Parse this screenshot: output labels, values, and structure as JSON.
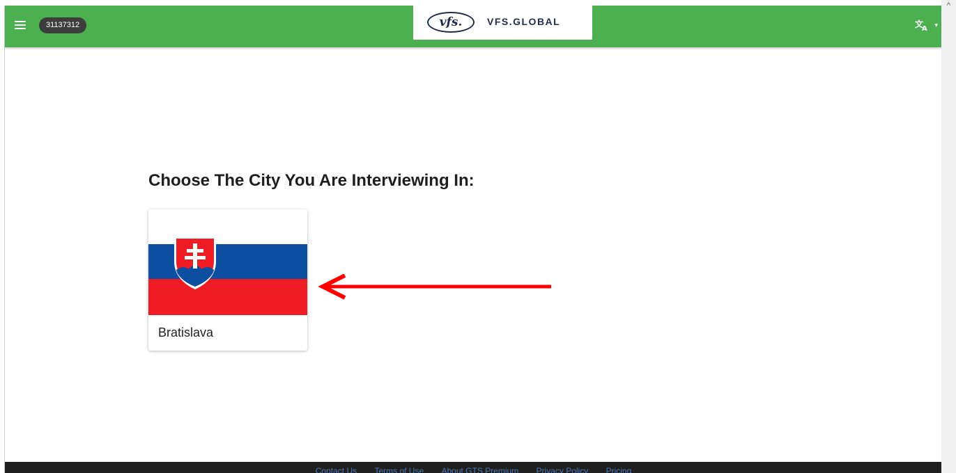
{
  "header": {
    "menu_icon": "menu-icon",
    "session_id": "31137312",
    "logo": {
      "mark": "vfs.",
      "text": "VFS.GLOBAL"
    },
    "language_icon": "translate-icon",
    "language_caret": "▾",
    "bar_color": "#4caf50"
  },
  "main": {
    "title": "Choose The City You Are Interviewing In:",
    "cities": [
      {
        "name": "Bratislava",
        "flag_icon": "slovakia-flag-icon"
      }
    ],
    "annotation": {
      "icon": "red-arrow-icon",
      "color": "#ff0000"
    }
  },
  "footer": {
    "links": [
      "Contact Us",
      "Terms of Use",
      "About GTS Premium",
      "Privacy Policy",
      "Pricing"
    ],
    "background": "#1f1f1f",
    "link_color": "#4f75b8"
  },
  "scrollbar": {
    "up_icon": "scroll-up-icon"
  }
}
